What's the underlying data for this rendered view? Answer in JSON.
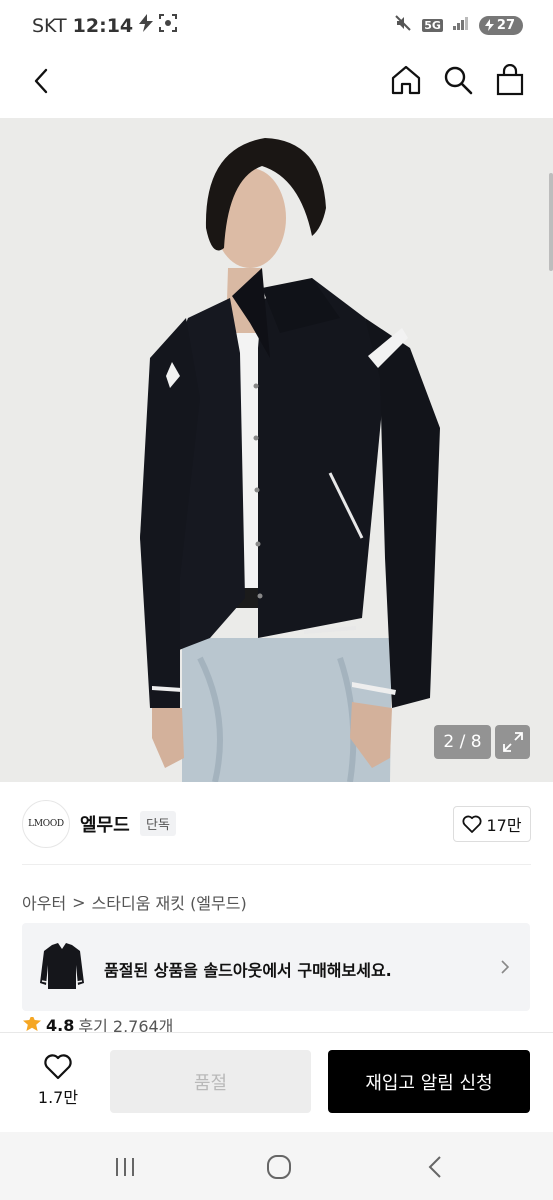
{
  "status_bar": {
    "carrier": "SKT",
    "time": "12:14",
    "network": "5G",
    "battery": "27"
  },
  "product_image": {
    "counter": "2 / 8"
  },
  "brand": {
    "logo_text": "LMOOD",
    "name": "엘무드",
    "badge": "단독",
    "likes": "17만"
  },
  "breadcrumb": {
    "category": "아우터",
    "separator": ">",
    "product_name": "스타디움 재킷 (엘무드)"
  },
  "soldout_banner": {
    "text": "품절된 상품을 솔드아웃에서 구매해보세요."
  },
  "rating": {
    "score": "4.8",
    "reviews": "후기 2,764개"
  },
  "bottom_bar": {
    "wish_count": "1.7만",
    "soldout_label": "품절",
    "restock_label": "재입고 알림 신청"
  },
  "colors": {
    "primary_button": "#000000",
    "disabled_button": "#ededed",
    "star": "#f5a623"
  }
}
